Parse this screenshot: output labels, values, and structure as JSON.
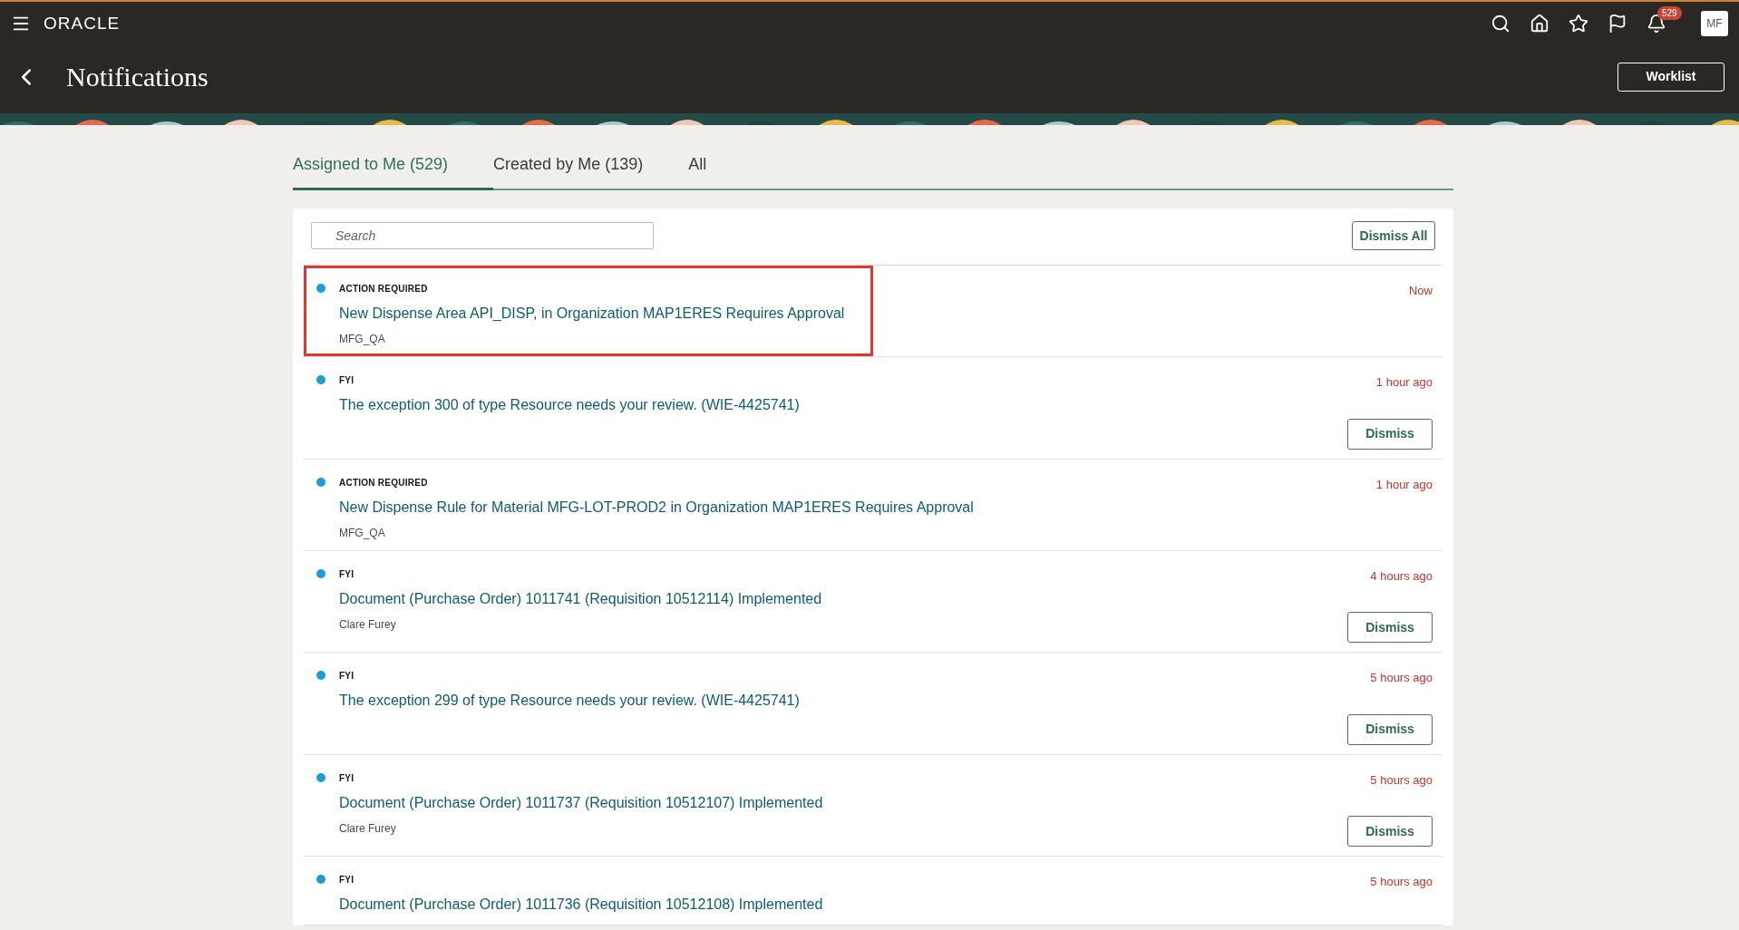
{
  "brand": "ORACLE",
  "header": {
    "badge": "529",
    "avatar": "MF",
    "title": "Notifications",
    "worklist": "Worklist"
  },
  "tabs": [
    {
      "label": "Assigned to Me (529)",
      "selected": true
    },
    {
      "label": "Created by Me (139)",
      "selected": false
    },
    {
      "label": "All",
      "selected": false
    }
  ],
  "search": {
    "placeholder": "Search"
  },
  "dismiss_all": "Dismiss All",
  "notifications": [
    {
      "type": "ACTION REQUIRED",
      "title": "New Dispense Area API_DISP, in Organization MAP1ERES Requires Approval",
      "sub": "MFG_QA",
      "time": "Now",
      "unread": true,
      "highlighted": true
    },
    {
      "type": "FYI",
      "title": "The exception 300 of type Resource needs your review. (WIE-4425741)",
      "time": "1 hour ago",
      "unread": true,
      "highlighted": false,
      "dismiss": "Dismiss"
    },
    {
      "type": "ACTION REQUIRED",
      "title": "New Dispense Rule for Material MFG-LOT-PROD2 in Organization MAP1ERES Requires Approval",
      "sub": "MFG_QA",
      "time": "1 hour ago",
      "unread": true,
      "highlighted": false
    },
    {
      "type": "FYI",
      "title": "Document (Purchase Order) 1011741 (Requisition 10512114) Implemented",
      "sub": "Clare Furey",
      "time": "4 hours ago",
      "unread": true,
      "highlighted": false,
      "dismiss": "Dismiss"
    },
    {
      "type": "FYI",
      "title": "The exception 299 of type Resource needs your review. (WIE-4425741)",
      "time": "5 hours ago",
      "unread": true,
      "highlighted": false,
      "dismiss": "Dismiss"
    },
    {
      "type": "FYI",
      "title": "Document (Purchase Order) 1011737 (Requisition 10512107) Implemented",
      "sub": "Clare Furey",
      "time": "5 hours ago",
      "unread": true,
      "highlighted": false,
      "dismiss": "Dismiss"
    },
    {
      "type": "FYI",
      "title": "Document (Purchase Order) 1011736 (Requisition 10512108) Implemented",
      "time": "5 hours ago",
      "unread": true,
      "highlighted": false
    }
  ]
}
